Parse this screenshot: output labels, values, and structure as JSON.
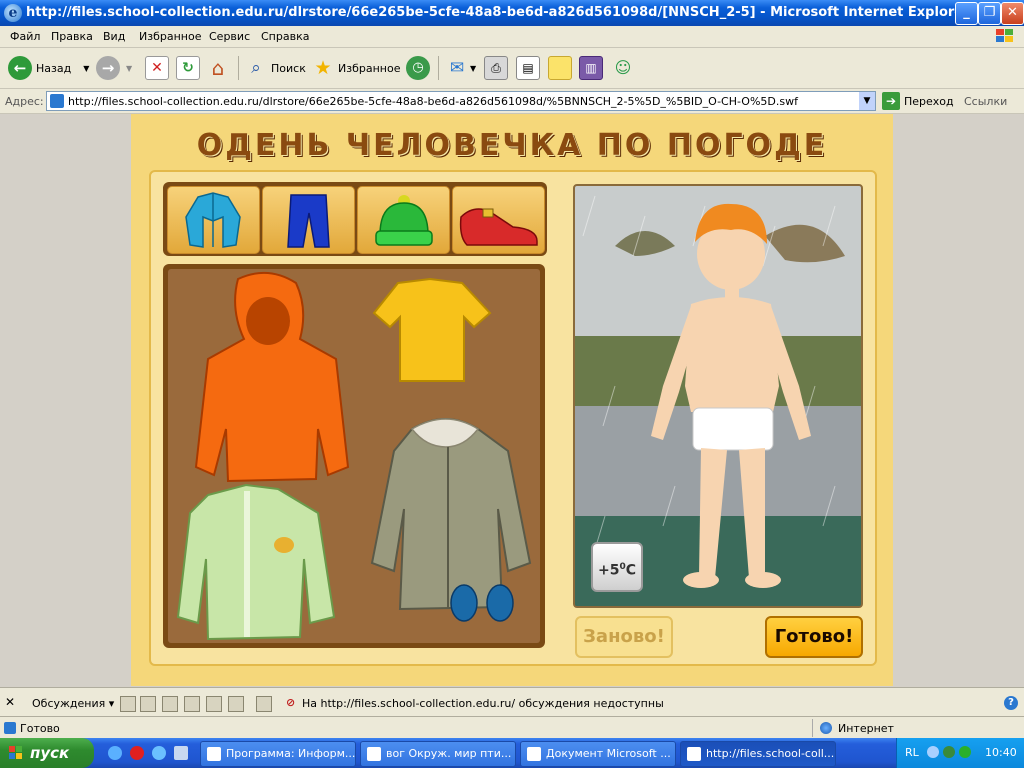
{
  "window": {
    "title": "http://files.school-collection.edu.ru/dlrstore/66e265be-5cfe-48a8-be6d-a826d561098d/[NNSCH_2-5] - Microsoft Internet Explorer",
    "minimize": "_",
    "maximize": "❐",
    "close": "✕"
  },
  "menu": [
    "Файл",
    "Правка",
    "Вид",
    "Избранное",
    "Сервис",
    "Справка"
  ],
  "toolbar": {
    "back": "Назад",
    "search": "Поиск",
    "favorites": "Избранное"
  },
  "address": {
    "label": "Адрес:",
    "url": "http://files.school-collection.edu.ru/dlrstore/66e265be-5cfe-48a8-be6d-a826d561098d/%5BNNSCH_2-5%5D_%5BID_O-CH-O%5D.swf",
    "go": "Переход",
    "links": "Ссылки"
  },
  "game": {
    "title": "ОДЕНЬ ЧЕЛОВЕЧКА ПО ПОГОДЕ",
    "categories": [
      "jacket-icon",
      "pants-icon",
      "hat-icon",
      "shoe-icon"
    ],
    "clothes": [
      "orange-hoodie",
      "yellow-tshirt",
      "green-jacket",
      "grey-coat",
      "blue-mittens"
    ],
    "temperature": "+5",
    "temperature_unit": "0",
    "temperature_suffix": "C",
    "reset_button": "Заново!",
    "done_button": "Готово!",
    "colors": {
      "background": "#f5d77a",
      "title": "#8a4a10",
      "done": "#f7a800"
    }
  },
  "discussion": {
    "label": "Обсуждения",
    "message": "На http://files.school-collection.edu.ru/ обсуждения недоступны"
  },
  "status": {
    "left": "Готово",
    "zone": "Интернет"
  },
  "taskbar": {
    "start": "пуск",
    "tasks": [
      "Программа: Информ...",
      "вог Окруж. мир пти...",
      "Документ Microsoft ...",
      "http://files.school-coll..."
    ],
    "lang": "RL",
    "clock": "10:40"
  }
}
